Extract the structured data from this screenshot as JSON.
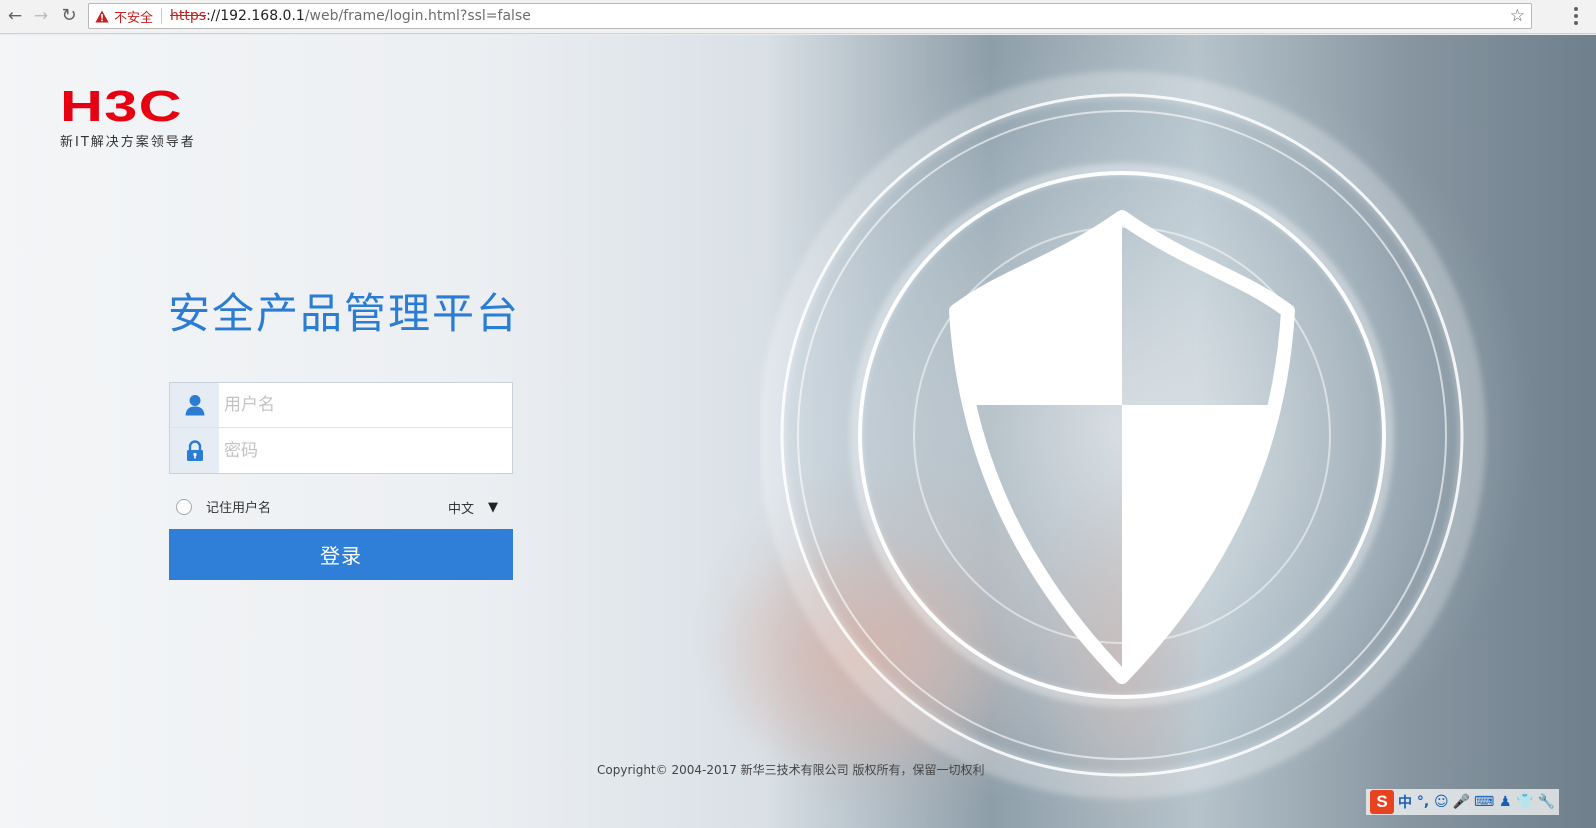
{
  "browser": {
    "security_label": "不安全",
    "url_scheme": "https",
    "url_host": "://192.168.0.1",
    "url_path": "/web/frame/login.html?ssl=false",
    "back_glyph": "←",
    "forward_glyph": "→",
    "reload_glyph": "↻",
    "star_glyph": "☆"
  },
  "logo": {
    "brand": "H3C",
    "slogan": "新IT解决方案领导者",
    "color": "#e60012"
  },
  "login": {
    "title": "安全产品管理平台",
    "username_placeholder": "用户名",
    "password_placeholder": "密码",
    "remember_label": "记住用户名",
    "language_value": "中文",
    "language_caret": "▼",
    "submit_label": "登录",
    "accent_color": "#2f7fd8"
  },
  "footer": {
    "copyright": "Copyright© 2004-2017 新华三技术有限公司 版权所有，保留一切权利"
  },
  "ime_toolbar": {
    "logo": "S",
    "items": [
      "中",
      "°,",
      "☺",
      "🎤",
      "⌨",
      "♟",
      "👕",
      "🔧"
    ]
  }
}
